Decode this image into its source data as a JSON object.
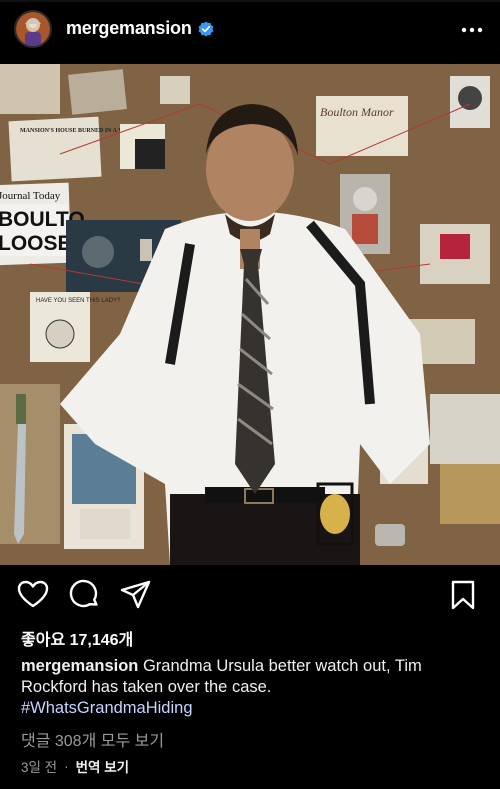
{
  "post": {
    "username": "mergemansion",
    "likes": "좋아요 17,146개",
    "caption_text": "Grandma Ursula better watch out, Tim Rockford has taken over the case.",
    "hashtag": "#WhatsGrandmaHiding",
    "comments": "댓글 308개 모두 보기",
    "time": "3일 전",
    "translate": "번역 보기"
  },
  "photo_text": {
    "newspaper_headline": "BOULTON LOOSE!!",
    "newspaper_masthead": "Journal Today",
    "manor_card": "Boulton Manor",
    "mansion_burned": "MANSION'S HOUSE BURNED IN A VIOLENT FIRE",
    "have_you_seen": "HAVE YOU SEEN THIS LADY?"
  },
  "icons": {
    "verified": "verified-badge-icon",
    "more": "more-options-icon",
    "like": "heart-icon",
    "comment": "comment-bubble-icon",
    "share": "paper-plane-icon",
    "save": "bookmark-icon"
  },
  "colors": {
    "background": "#000000",
    "verified_blue": "#3897f0",
    "hashtag": "#c6d4ff"
  }
}
